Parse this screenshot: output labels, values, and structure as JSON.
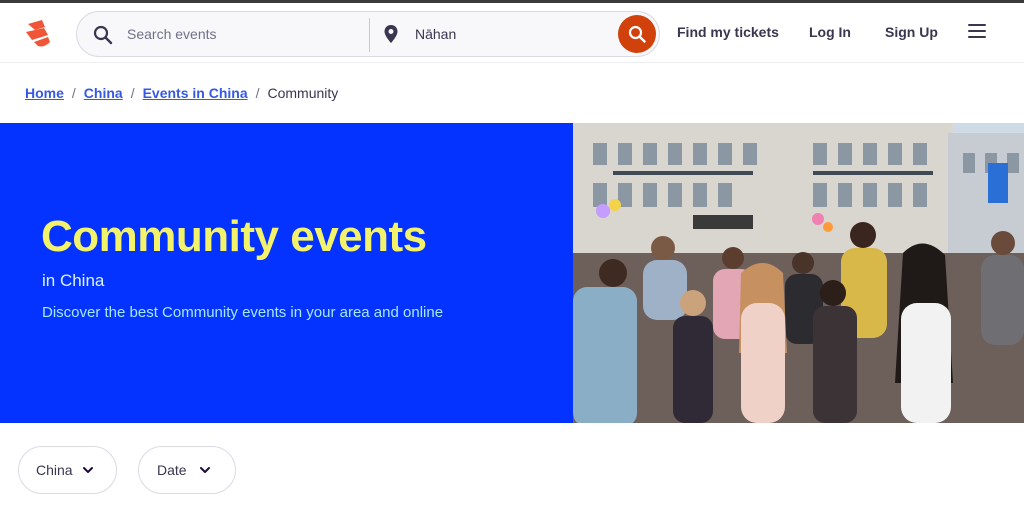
{
  "header": {
    "logo_icon": "eventbrite-logo-icon",
    "brand_color": "#f05537",
    "search": {
      "placeholder": "Search events",
      "icon": "search-icon"
    },
    "location": {
      "value": "Nāhan",
      "icon": "map-pin-icon"
    },
    "search_button_color": "#d1410c",
    "nav": {
      "find_tickets": "Find my tickets",
      "log_in": "Log In",
      "sign_up": "Sign Up"
    },
    "menu_icon": "hamburger-menu-icon"
  },
  "breadcrumb": {
    "items": [
      "Home",
      "China",
      "Events in China"
    ],
    "current": "Community",
    "separator": "/"
  },
  "hero": {
    "title": "Community events",
    "subtitle": "in China",
    "description": "Discover the best Community events in your area and online",
    "background_color": "#0433ff",
    "title_color": "#f3f36b"
  },
  "filters": {
    "location": "China",
    "date": "Date"
  }
}
